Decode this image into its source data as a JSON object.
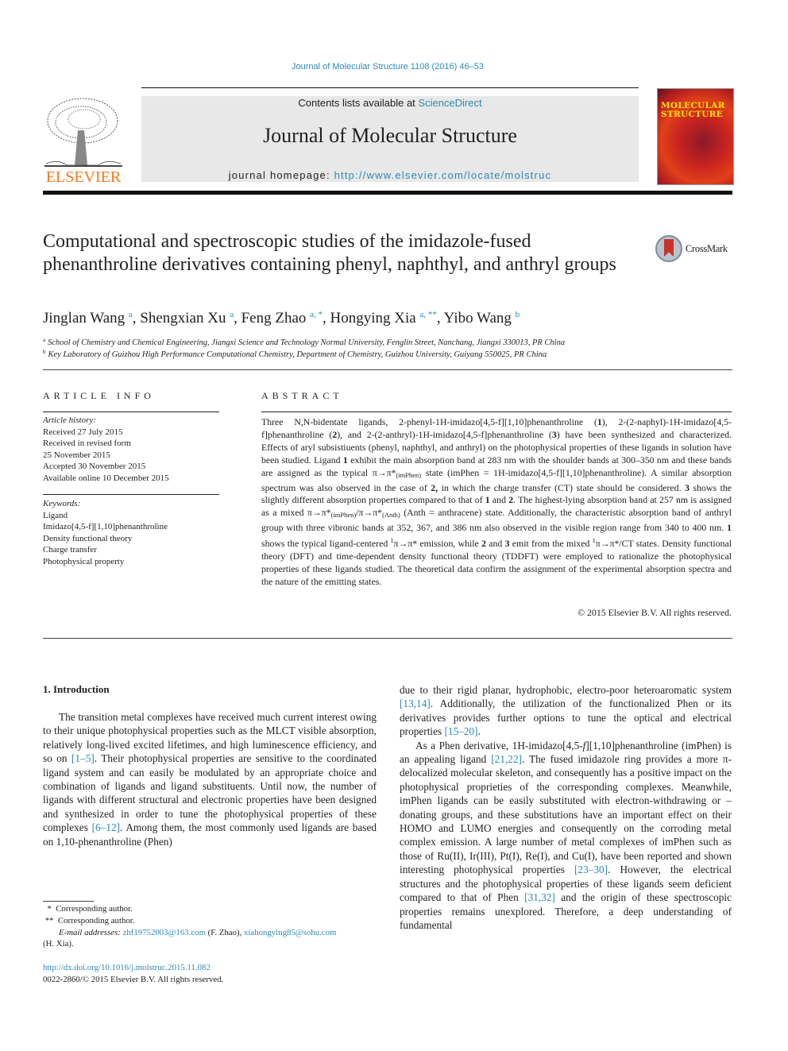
{
  "header": {
    "journal_ref": "Journal of Molecular Structure 1108 (2016) 46–53",
    "contents_prefix": "Contents lists available at ",
    "contents_link": "ScienceDirect",
    "journal_name": "Journal of Molecular Structure",
    "homepage_prefix": "journal homepage: ",
    "homepage_url": "http://www.elsevier.com/locate/molstruc",
    "publisher_logo_text": "ELSEVIER",
    "cover_title_line1": "MOLECULAR",
    "cover_title_line2": "STRUCTURE",
    "crossmark_label": "CrossMark"
  },
  "article": {
    "title": "Computational and spectroscopic studies of the imidazole-fused phenanthroline derivatives containing phenyl, naphthyl, and anthryl groups",
    "authors": [
      {
        "name": "Jinglan Wang",
        "sup": "a"
      },
      {
        "name": "Shengxian Xu",
        "sup": "a"
      },
      {
        "name": "Feng Zhao",
        "sup": "a, *"
      },
      {
        "name": "Hongying Xia",
        "sup": "a, **"
      },
      {
        "name": "Yibo Wang",
        "sup": "b"
      }
    ],
    "affiliations": [
      {
        "key": "a",
        "text": "School of Chemistry and Chemical Engineering, Jiangxi Science and Technology Normal University, Fenglin Street, Nanchang, Jiangxi 330013, PR China"
      },
      {
        "key": "b",
        "text": "Key Laboratory of Guizhou High Performance Computational Chemistry, Department of Chemistry, Guizhou University, Guiyang 550025, PR China"
      }
    ]
  },
  "article_info": {
    "heading": "ARTICLE INFO",
    "history_label": "Article history:",
    "history": [
      "Received 27 July 2015",
      "Received in revised form",
      "25 November 2015",
      "Accepted 30 November 2015",
      "Available online 10 December 2015"
    ],
    "keywords_label": "Keywords:",
    "keywords": [
      "Ligand",
      "Imidazo[4,5-f][1,10]phenanthroline",
      "Density functional theory",
      "Charge transfer",
      "Photophysical property"
    ]
  },
  "abstract": {
    "heading": "ABSTRACT",
    "s1": "Three N,N-bidentate ligands, 2-phenyl-1H-imidazo[4,5-f][1,10]phenanthroline (",
    "b1": "1",
    "s2": "), 2-(2-naphyl)-1H-imidazo[4,5-f]phenanthroline (",
    "b2": "2",
    "s3": "), and 2-(2-anthryl)-1H-imidazo[4,5-f]phenanthroline (",
    "b3": "3",
    "s4": ") have been synthesized and characterized. Effects of aryl subsistiuents (phenyl, naphthyl, and anthryl) on the photophysical properties of these ligands in solution have been studied. Ligand ",
    "b4": "1",
    "s5": " exhibit the main absorption band at 283 nm with the shoulder bands at 300–350 nm and these bands are assigned as the typical π→π*",
    "sub1": "(imPhen)",
    "s6": " state (imPhen = 1H-imidazo[4,5-f][1,10]phenanthroline). A similar absorption spectrum was also observed in the case of ",
    "b5": "2,",
    "s7": " in which the charge transfer (CT) state should be considered. ",
    "b6": "3",
    "s8": " shows the slightly different absorption properties compared to that of ",
    "b7": "1",
    "s9": " and ",
    "b8": "2",
    "s10": ". The highest-lying absorption band at 257 nm is assigned as a mixed π→π*",
    "sub2": "(imPhen)",
    "s11": "/π→π*",
    "sub3": "(Anth)",
    "s12": " (Anth = anthracene) state. Additionally, the characteristic absorption band of anthryl group with three vibronic bands at 352, 367, and 386 nm also observed in the visible region range from 340 to 400 nm. ",
    "b9": "1",
    "s13": " shows the typical ligand-centered ",
    "sup1": "1",
    "s14": "π→π* emission, while ",
    "b10": "2",
    "s15": " and ",
    "b11": "3",
    "s16": " emit from the mixed ",
    "sup2": "1",
    "s17": "π→π*/CT states. Density functional theory (DFT) and time-dependent density functional theory (TDDFT) were employed to rationalize the photophysical properties of these ligands studied. The theoretical data confirm the assignment of the experimental absorption spectra and the nature of the emitting states.",
    "copyright": "© 2015 Elsevier B.V. All rights reserved."
  },
  "introduction": {
    "heading": "1.  Introduction",
    "p1_a": "The transition metal complexes have received much current interest owing to their unique photophysical properties such as the MLCT visible absorption, relatively long-lived excited lifetimes, and high luminescence efficiency, and so on ",
    "ref1": "[1–5]",
    "p1_b": ". Their photophysical properties are sensitive to the coordinated ligand system and can easily be modulated by an appropriate choice and combination of ligands and ligand substituents. Until now, the number of ligands with different structural and electronic properties have been designed and synthesized in order to tune the photophysical properties of these complexes ",
    "ref2": "[6–12]",
    "p1_c": ". Among them, the most commonly used ligands are based on 1,10-phenanthroline (Phen)",
    "r1_a": "due to their rigid planar, hydrophobic, electro-poor heteroaromatic system ",
    "ref3": "[13,14]",
    "r1_b": ". Additionally, the utilization of the functionalized Phen or its derivatives provides further options to tune the optical and electrical properties ",
    "ref4": "[15–20]",
    "r1_c": ".",
    "p2_a": "As a Phen derivative, 1H-imidazo[4,5-",
    "p2_f": "f",
    "p2_b": "][1,10]phenanthroline (imPhen) is an appealing ligand ",
    "ref5": "[21,22]",
    "p2_c": ". The fused imidazole ring provides a more π-delocalized molecular skeleton, and consequently has a positive impact on the photophysical proprieties of the corresponding complexes. Meanwhile, imPhen ligands can be easily substituted with electron-withdrawing or –donating groups, and these substitutions have an important effect on their HOMO and LUMO energies and consequently on the corroding metal complex emission. A large number of metal complexes of imPhen such as those of Ru(II), Ir(III), Pt(I), Re(I), and Cu(I), have been reported and shown interesting photophysical properties ",
    "ref6": "[23–30]",
    "p2_d": ". However, the electrical structures and the photophysical properties of these ligands seem deficient compared to that of Phen ",
    "ref7": "[31,32]",
    "p2_e": " and the origin of these spectroscopic properties remains unexplored. Therefore, a deep understanding of fundamental"
  },
  "footnotes": {
    "fn1": "  *  Corresponding author.",
    "fn2": " **  Corresponding author.",
    "email_label": "E-mail addresses: ",
    "email1": "zhf19752003@163.com",
    "email1_owner": " (F. Zhao), ",
    "email2": "xiahongying85@sohu.com",
    "email2_owner": "(H. Xia).",
    "doi": "http://dx.doi.org/10.1016/j.molstruc.2015.11.082",
    "issn": "0022-2860/© 2015 Elsevier B.V. All rights reserved."
  }
}
